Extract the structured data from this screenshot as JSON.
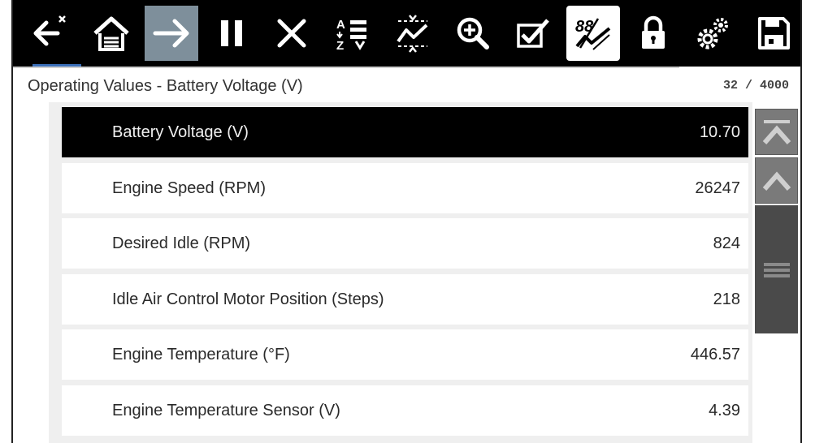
{
  "toolbar": {
    "buttons": [
      {
        "icon": "back-exit-icon"
      },
      {
        "icon": "home-icon"
      },
      {
        "icon": "forward-icon",
        "active": true
      },
      {
        "icon": "pause-icon"
      },
      {
        "icon": "close-icon"
      },
      {
        "icon": "sort-az-icon"
      },
      {
        "icon": "zoom-graph-icon"
      },
      {
        "icon": "zoom-in-icon"
      },
      {
        "icon": "checklist-icon"
      },
      {
        "icon": "pid-chart-icon",
        "active": true
      },
      {
        "icon": "lock-icon"
      },
      {
        "icon": "settings-icon"
      },
      {
        "icon": "save-icon"
      }
    ]
  },
  "header": {
    "title": "Operating Values - Battery Voltage (V)",
    "count": "32 / 4000"
  },
  "rows": [
    {
      "label": "Battery Voltage (V)",
      "value": "10.70",
      "selected": true
    },
    {
      "label": "Engine Speed (RPM)",
      "value": "26247"
    },
    {
      "label": "Desired Idle (RPM)",
      "value": "824"
    },
    {
      "label": "Idle Air Control Motor Position (Steps)",
      "value": "218"
    },
    {
      "label": "Engine Temperature (°F)",
      "value": "446.57"
    },
    {
      "label": "Engine Temperature Sensor (V)",
      "value": "4.39"
    }
  ],
  "colors": {
    "toolbar_bg": "#000000",
    "selected_row_bg": "#000000",
    "active_button_bg": "#7e8f9b",
    "scroll_button": "#7a7a7a",
    "scroll_thumb": "#4a4a4a"
  }
}
